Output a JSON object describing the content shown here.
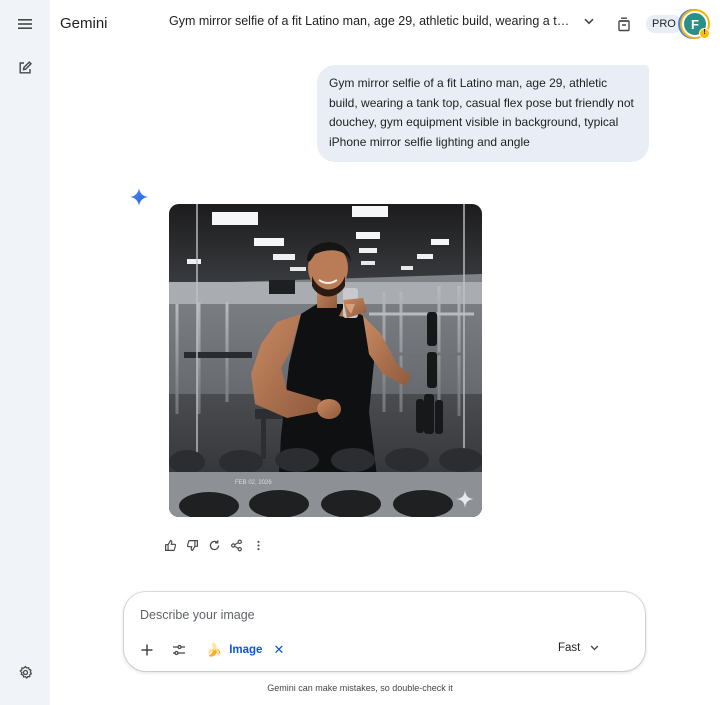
{
  "app": {
    "name": "Gemini",
    "accent": "#0b57d0",
    "rail_bg": "#f0f4f9",
    "bubble_bg": "#e9eef6"
  },
  "sidebar": {
    "icons": [
      "menu-icon",
      "new-chat-icon",
      "settings-icon"
    ]
  },
  "header": {
    "conversation_title": "Gym mirror selfie of a fit Latino man, age 29, athletic build, wearing a tank to...",
    "plan_badge": "PRO",
    "avatar_initial": "F"
  },
  "conversation": {
    "user_prompt": "Gym mirror selfie of a fit Latino man, age 29, athletic build, wearing a tank top, casual flex pose but friendly not douchey, gym equipment visible in background, typical iPhone mirror selfie lighting and angle",
    "image_date_stamp": "FEB 02, 2026",
    "response_actions": [
      "thumbs-up-icon",
      "thumbs-down-icon",
      "redo-icon",
      "share-icon",
      "more-vert-icon"
    ]
  },
  "composer": {
    "placeholder": "Describe your image",
    "tool_chip_label": "Image",
    "model_label": "Fast"
  },
  "footer": {
    "disclaimer": "Gemini can make mistakes, so double-check it"
  }
}
